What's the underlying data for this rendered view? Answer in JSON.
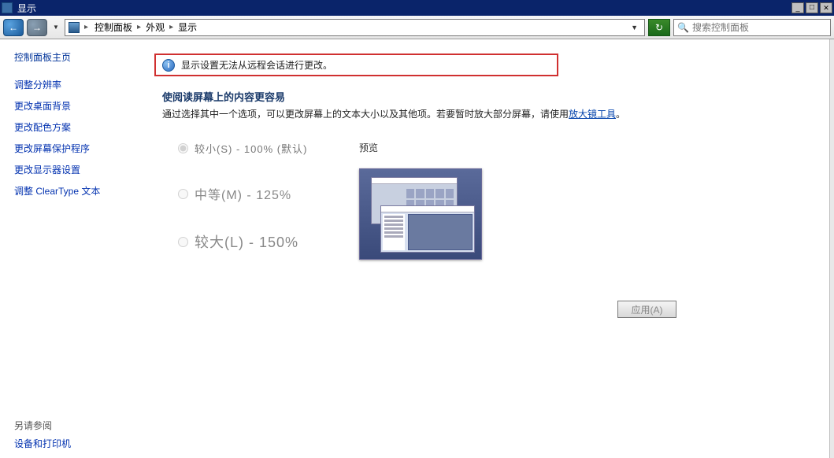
{
  "window": {
    "title": "显示",
    "min": "_",
    "max": "□",
    "close": "✕"
  },
  "breadcrumb": {
    "seg1": "控制面板",
    "seg2": "外观",
    "seg3": "显示"
  },
  "search": {
    "placeholder": "搜索控制面板"
  },
  "sidebar": {
    "home": "控制面板主页",
    "links": {
      "l1": "调整分辨率",
      "l2": "更改桌面背景",
      "l3": "更改配色方案",
      "l4": "更改屏幕保护程序",
      "l5": "更改显示器设置",
      "l6": "调整 ClearType 文本"
    },
    "see_also_hd": "另请参阅",
    "see_also_link": "设备和打印机"
  },
  "alert": {
    "message": "显示设置无法从远程会话进行更改。"
  },
  "content": {
    "heading": "使阅读屏幕上的内容更容易",
    "desc_prefix": "通过选择其中一个选项，可以更改屏幕上的文本大小以及其他项。若要暂时放大部分屏幕，请使用",
    "desc_link": "放大镜工具",
    "desc_suffix": "。"
  },
  "options": {
    "o1": "较小(S) - 100% (默认)",
    "o2": "中等(M) - 125%",
    "o3": "较大(L) - 150%"
  },
  "preview_label": "预览",
  "apply_btn": "应用(A)"
}
